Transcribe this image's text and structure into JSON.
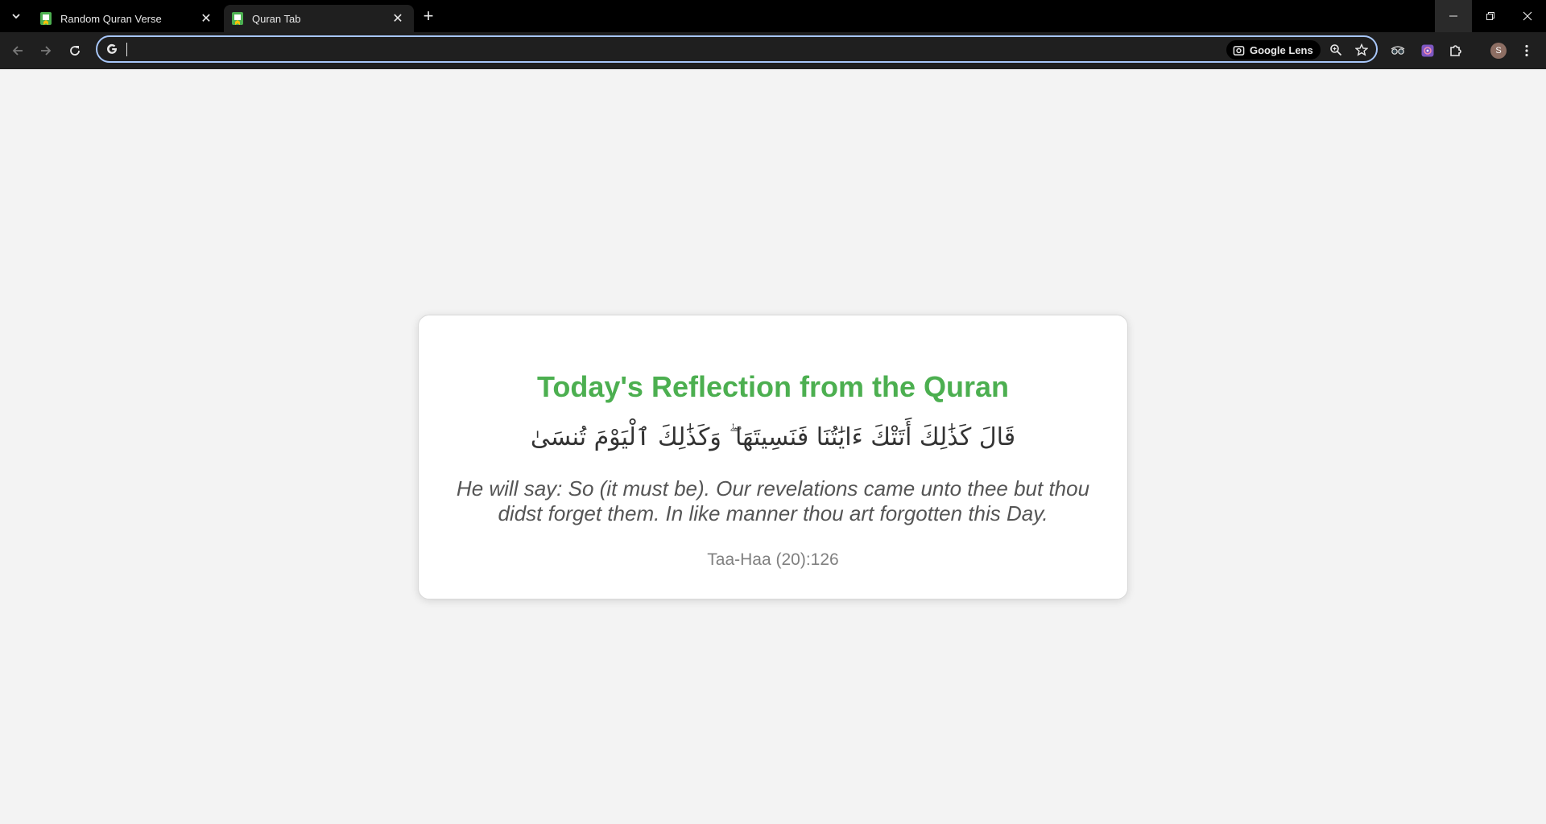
{
  "browser": {
    "tabs": [
      {
        "title": "Random Quran Verse",
        "active": false
      },
      {
        "title": "Quran Tab",
        "active": true
      }
    ],
    "address_bar": {
      "value": "",
      "lens_label": "Google Lens"
    },
    "profile_initial": "S",
    "colors": {
      "frame": "#000000",
      "toolbar": "#1f1f1f",
      "focus_ring": "#a8c7fa",
      "favicon_green": "#4caf50"
    }
  },
  "page": {
    "title": "Today's Reflection from the Quran",
    "arabic": "قَالَ كَذَٰلِكَ أَتَتْكَ ءَايَٰتُنَا فَنَسِيتَهَا ۖ وَكَذَٰلِكَ ٱلْيَوْمَ تُنسَىٰ",
    "translation": "He will say: So (it must be). Our revelations came unto thee but thou didst forget them. In like manner thou art forgotten this Day.",
    "reference": "Taa-Haa (20):126",
    "accent_color": "#4caf50"
  }
}
